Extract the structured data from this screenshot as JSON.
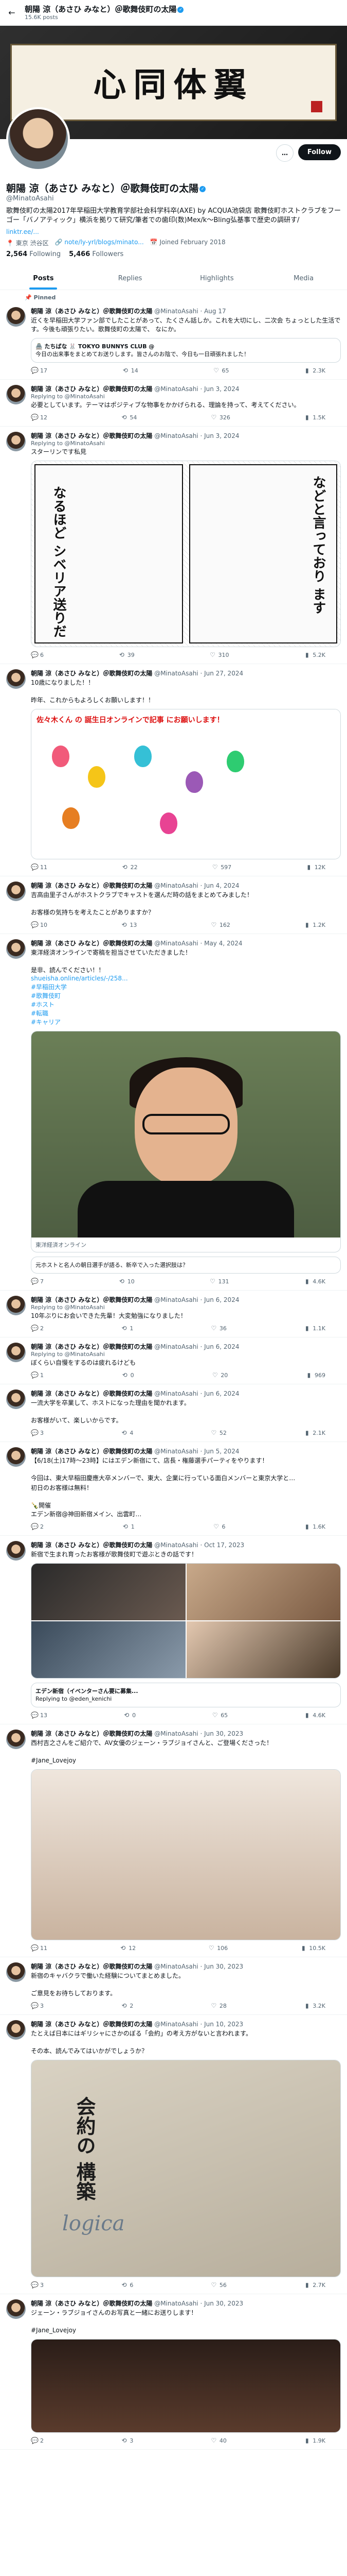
{
  "header": {
    "name": "朝陽 涼（あさひ みなと）＠歌舞伎町の太陽",
    "posts": "15.6K posts"
  },
  "banner": {
    "calligraphy": "心同体翼"
  },
  "profile": {
    "follow_label": "Follow",
    "more_label": "…",
    "name": "朝陽 涼（あさひ みなと）＠歌舞伎町の太陽",
    "handle": "@MinatoAsahi",
    "bio": "歌舞伎町の太陽2017年早稲田大学教育学部社会科学科卒(AXE) by ACQUA池袋店 歌舞伎町ホストクラブをフーゴー「バノアティック」横浜を拠りて研究/筆者での歯印(数)Mex/k～Bling弘基事で歴史の調研す/",
    "bio_link": "linktr.ee/...",
    "location": "東京 渋谷区",
    "website": "note/ly-yrl/blogs/minato...",
    "joined": "Joined February 2018",
    "following_count": "2,564",
    "following_label": "Following",
    "followers_count": "5,466",
    "followers_label": "Followers"
  },
  "tabs": [
    {
      "label": "Posts"
    },
    {
      "label": "Replies"
    },
    {
      "label": "Highlights"
    },
    {
      "label": "Media"
    }
  ],
  "posts": [
    {
      "pinned": "Pinned",
      "name": "朝陽 涼（あさひ みなと）＠歌舞伎町の太陽",
      "handle": "@MinatoAsahi",
      "date": "· Aug 17",
      "text": "近くを早稲田大学ファン部でしたことがあって、たくさん話しか。これを大切にし、二次会 ちょっとした生活です。今後も頑張りたい。歌舞伎町の太陽で、 なにか。",
      "quote_author": "🏯 たちばな 🐰 TOKYO BUNNYS CLUB @",
      "quote_text": "今日の出来事をまとめてお送りします。皆さんのお陰で、今日も一日頑張れました！",
      "replies": "17",
      "reposts": "14",
      "likes": "65",
      "views": "2.3K"
    },
    {
      "name": "朝陽 涼（あさひ みなと）＠歌舞伎町の太陽",
      "handle": "@MinatoAsahi",
      "date": "· Jun 3, 2024",
      "replying": "Replying to @MinatoAsahi",
      "text": "必要としています。テーマはポジティブな物事をかかげられる、理論を持って、考えてください。",
      "replies": "12",
      "reposts": "54",
      "likes": "326",
      "views": "1.5K"
    },
    {
      "name": "朝陽 涼（あさひ みなと）＠歌舞伎町の太陽",
      "handle": "@MinatoAsahi",
      "date": "· Jun 3, 2024",
      "replying": "Replying to @MinatoAsahi",
      "text": "スターリンです私見",
      "manga_text_1": "などと言っており ます",
      "manga_text_2": "なるほど シベリア送りだ",
      "replies": "6",
      "reposts": "39",
      "likes": "310",
      "views": "5.2K"
    },
    {
      "name": "朝陽 涼（あさひ みなと）＠歌舞伎町の太陽",
      "handle": "@MinatoAsahi",
      "date": "· Jun 27, 2024",
      "text": "10歳になりました！！\n\n昨年、これからもよろしくお願いします！！",
      "card_title": "佐々木くん の 誕生日オンラインで記事 にお願いします！",
      "replies": "11",
      "reposts": "22",
      "likes": "597",
      "views": "12K"
    },
    {
      "name": "朝陽 涼（あさひ みなと）＠歌舞伎町の太陽",
      "handle": "@MinatoAsahi",
      "date": "· Jun 4, 2024",
      "text": "吉高由里子さんがホストクラブでキャストを選んだ時の話をまとめてみました！\n\nお客様の気持ちを考えたことがありますか？",
      "replies": "10",
      "reposts": "13",
      "likes": "162",
      "views": "1.2K"
    },
    {
      "name": "朝陽 涼（あさひ みなと）＠歌舞伎町の太陽",
      "handle": "@MinatoAsahi",
      "date": "· May 4, 2024",
      "text": "東洋経済オンラインで寄稿を担当させていただきました！\n\n是非、読んでください！！",
      "link": "shueisha.online/articles/-/258...",
      "tags": "#早稲田大学\n#歌舞伎町\n#ホスト\n#転職\n#キャリア",
      "card_domain": "東洋経済オンライン",
      "card_title": "元ホストと名人の朝日選手が語る、新卒で入った選択肢は？",
      "replies": "7",
      "reposts": "10",
      "likes": "131",
      "views": "4.6K"
    },
    {
      "name": "朝陽 涼（あさひ みなと）＠歌舞伎町の太陽",
      "handle": "@MinatoAsahi",
      "date": "· Jun 6, 2024",
      "replying": "Replying to @MinatoAsahi",
      "text": "10年ぶりにお会いできた先輩！大変勉強になりました！",
      "replies": "2",
      "reposts": "1",
      "likes": "36",
      "views": "1.1K"
    },
    {
      "name": "朝陽 涼（あさひ みなと）＠歌舞伎町の太陽",
      "handle": "@MinatoAsahi",
      "date": "· Jun 6, 2024",
      "replying": "Replying to @MinatoAsahi",
      "text": "ぼくらい自慢をするのは疲れるけども",
      "replies": "1",
      "reposts": "0",
      "likes": "20",
      "views": "969"
    },
    {
      "name": "朝陽 涼（あさひ みなと）＠歌舞伎町の太陽",
      "handle": "@MinatoAsahi",
      "date": "· Jun 6, 2024",
      "text": "一流大学を卒業して、ホストになった理由を聞かれます。\n\nお客様がいて、楽しいからです。",
      "replies": "3",
      "reposts": "4",
      "likes": "52",
      "views": "2.1K"
    },
    {
      "name": "朝陽 涼（あさひ みなと）＠歌舞伎町の太陽",
      "handle": "@MinatoAsahi",
      "date": "· Jun 5, 2024",
      "text": "【6/18(土)17時〜23時】にはエデン新宿にて、店長・権藤選手パーティをやります！\n\n今回は、東大早稲田慶應大卒メンバーで、東大、企業に行っている面白メンバーと東京大学と…",
      "text2": "初日のお客様は無料！\n\n🍾開催\nエデン新宿@神田新宿メイン、出雲町…",
      "replies": "2",
      "reposts": "1",
      "likes": "6",
      "views": "1.6K"
    },
    {
      "name": "朝陽 涼（あさひ みなと）＠歌舞伎町の太陽",
      "handle": "@MinatoAsahi",
      "date": "· Oct 17, 2023",
      "quote_author": "エデン新宿（イベンターさん要に募集...",
      "quote_text": "Replying to @eden_kenichi",
      "text": "新宿で生まれ育ったお客様が歌舞伎町で遊ぶときの話です！",
      "replies": "13",
      "reposts": "0",
      "likes": "65",
      "views": "4.6K"
    },
    {
      "name": "朝陽 涼（あさひ みなと）＠歌舞伎町の太陽",
      "handle": "@MinatoAsahi",
      "date": "· Jun 30, 2023",
      "text": "西村吉之さんをご紹介で、AV女優のジェーン・ラブジョイさんと、ご登場くださった！\n\n#Jane_Lovejoy",
      "replies": "11",
      "reposts": "12",
      "likes": "106",
      "views": "10.5K"
    },
    {
      "name": "朝陽 涼（あさひ みなと）＠歌舞伎町の太陽",
      "handle": "@MinatoAsahi",
      "date": "· Jun 30, 2023",
      "text": "新宿のキャバクラで働いた経験についてまとめました。\n\nご意見をお待ちしております。",
      "replies": "3",
      "reposts": "2",
      "likes": "28",
      "views": "3.2K"
    },
    {
      "name": "朝陽 涼（あさひ みなと）＠歌舞伎町の太陽",
      "handle": "@MinatoAsahi",
      "date": "· Jun 10, 2023",
      "text": "たとえば日本にはギリシャにさかのぼる「会約」の考え方がないと言われます。\n\nその本、読んでみてはいかがでしょうか？",
      "book_title": "会約の 構築",
      "book_logo": "logica",
      "replies": "3",
      "reposts": "6",
      "likes": "56",
      "views": "2.7K"
    },
    {
      "name": "朝陽 涼（あさひ みなと）＠歌舞伎町の太陽",
      "handle": "@MinatoAsahi",
      "date": "· Jun 30, 2023",
      "text": "ジェーン・ラブジョイさんのお写真と一緒にお送りします！\n\n#Jane_Lovejoy",
      "replies": "2",
      "reposts": "3",
      "likes": "40",
      "views": "1.9K"
    }
  ]
}
